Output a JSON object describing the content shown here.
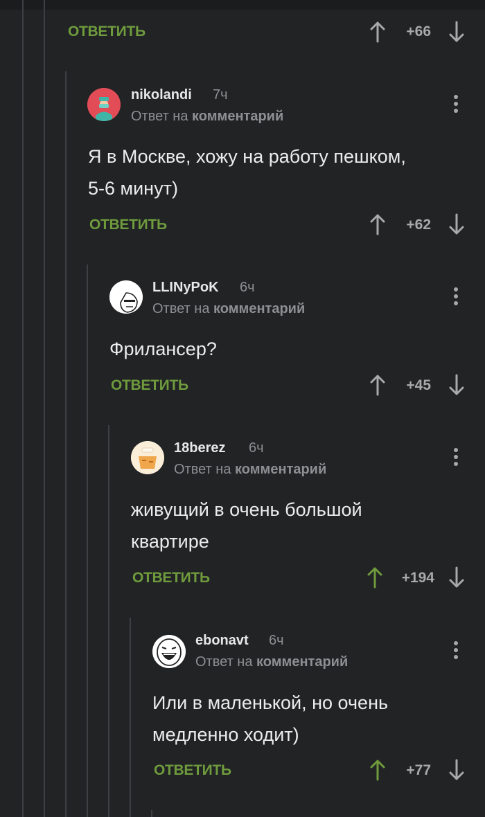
{
  "top_reply": {
    "reply_label": "ОТВЕТИТЬ",
    "score": "+66"
  },
  "comments": [
    {
      "username": "nikolandi",
      "time": "7ч",
      "reply_prefix": "Ответ на",
      "reply_link": "комментарий",
      "text_line1": "Я в Москве, хожу на работу пешком,",
      "text_line2": "5-6 минут)",
      "reply_label": "ОТВЕТИТЬ",
      "score": "+62"
    },
    {
      "username": "LLINyPoK",
      "time": "6ч",
      "reply_prefix": "Ответ на",
      "reply_link": "комментарий",
      "text_line1": "Фрилансер?",
      "reply_label": "ОТВЕТИТЬ",
      "score": "+45"
    },
    {
      "username": "18berez",
      "time": "6ч",
      "reply_prefix": "Ответ на",
      "reply_link": "комментарий",
      "text_line1": "живущий в очень большой",
      "text_line2": "квартире",
      "reply_label": "ОТВЕТИТЬ",
      "score": "+194",
      "upvoted": true
    },
    {
      "username": "ebonavt",
      "time": "6ч",
      "reply_prefix": "Ответ на",
      "reply_link": "комментарий",
      "text_line1": "Или в маленькой, но очень",
      "text_line2": "медленно ходит)",
      "reply_label": "ОТВЕТИТЬ",
      "score": "+77",
      "upvoted": true
    }
  ],
  "colors": {
    "background": "#212325",
    "reply_green": "#6f9b3d",
    "upvote_active": "#6f9b3d",
    "vote_inactive": "#a8a9ab",
    "thread_line": "#3d4043"
  },
  "icons": [
    "upvote-arrow-icon",
    "downvote-arrow-icon",
    "more-vertical-icon",
    "avatar"
  ]
}
